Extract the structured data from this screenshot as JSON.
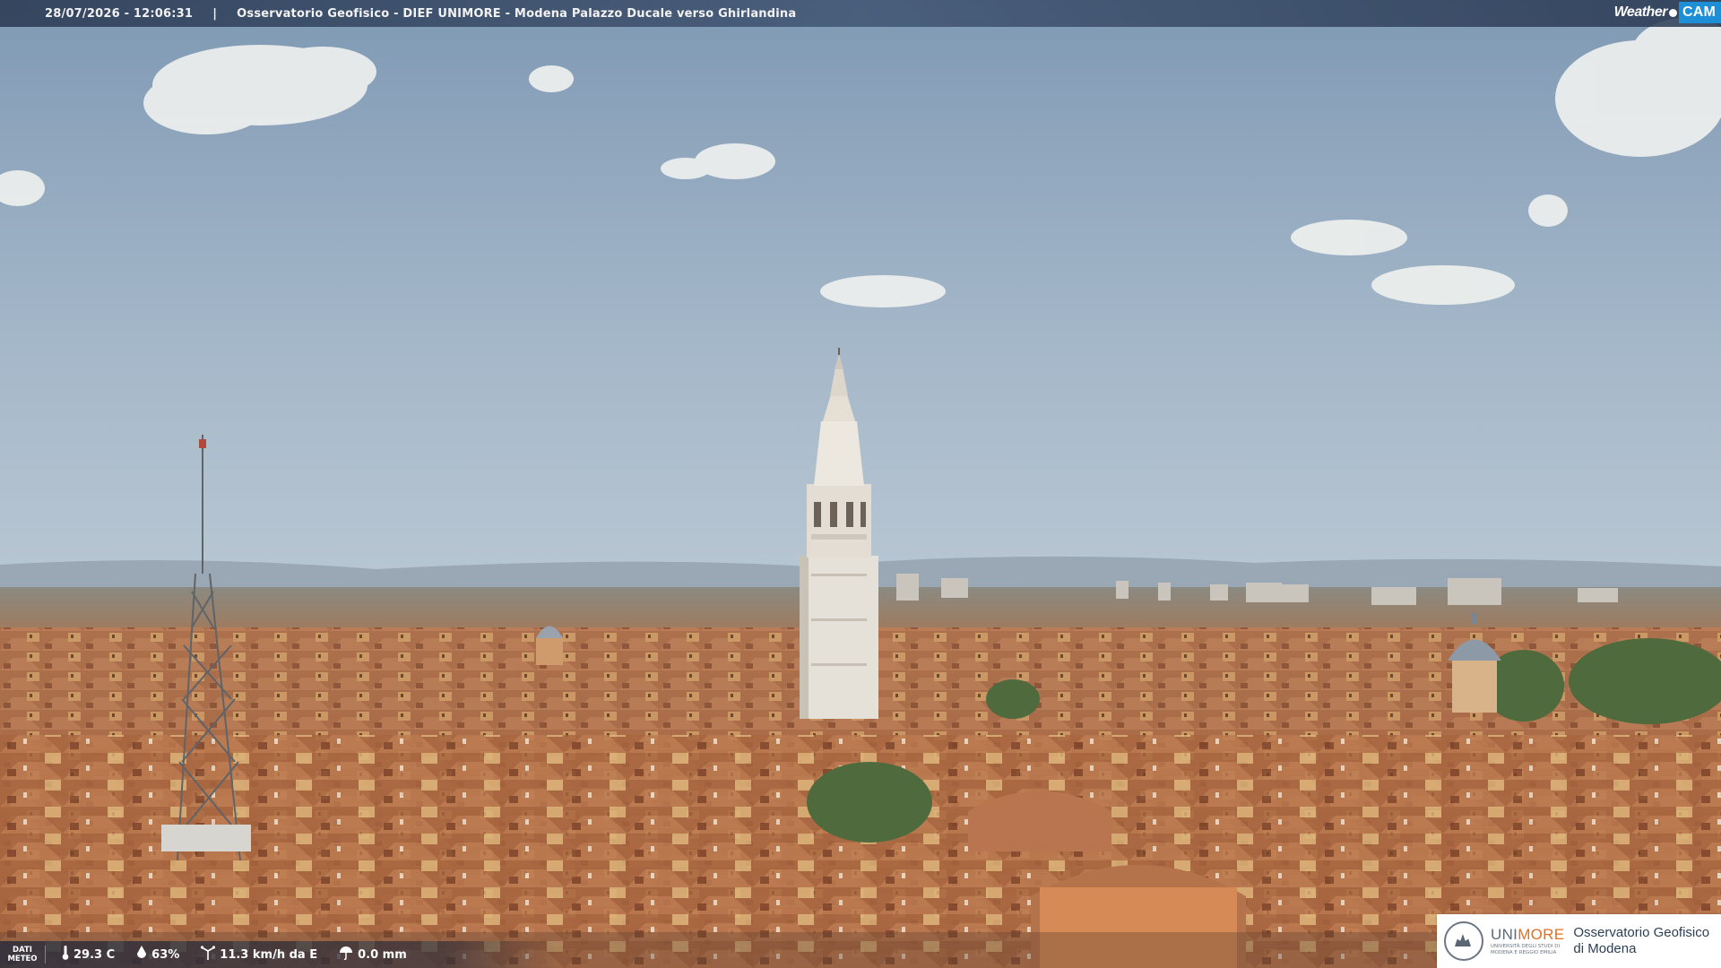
{
  "overlay": {
    "timestamp": "28/07/2026 - 12:06:31",
    "separator": "|",
    "title": "Osservatorio Geofisico - DIEF UNIMORE - Modena Palazzo Ducale verso Ghirlandina",
    "brand_weather": "Weather",
    "brand_cam": "CAM"
  },
  "meteo": {
    "label_line1": "DATI",
    "label_line2": "METEO",
    "temperature": "29.3 C",
    "humidity": "63%",
    "wind": "11.3 km/h da E",
    "rain": "0.0 mm"
  },
  "logo": {
    "uni_a": "UNI",
    "uni_b": "MORE",
    "uni_sub_line1": "UNIVERSITÀ DEGLI STUDI DI",
    "uni_sub_line2": "MODENA E REGGIO EMILIA",
    "observatory_line1": "Osservatorio Geofisico",
    "observatory_line2": "di Modena"
  },
  "colors": {
    "sky_top": "#7f99b4",
    "sky_horizon": "#b3c3d1",
    "roof": "#b2704a",
    "tower": "#e6e1d8",
    "brand_blue": "#1d8fd6",
    "unimore_orange": "#e07020"
  }
}
